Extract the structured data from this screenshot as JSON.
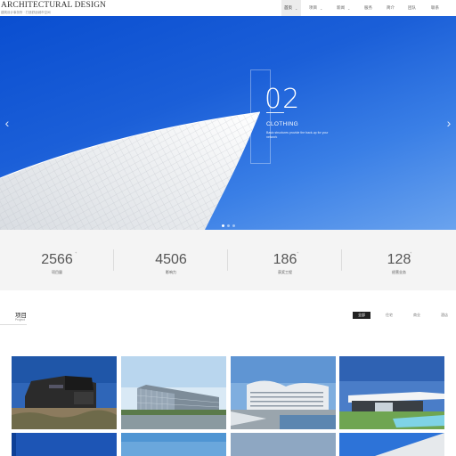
{
  "header": {
    "logo_title": "ARCHITECTURAL DESIGN",
    "logo_subtitle": "建筑设计事务所 · 打造舒适城市空间",
    "nav": [
      {
        "label": "首页",
        "active": true,
        "dropdown": true
      },
      {
        "label": "项目",
        "active": false,
        "dropdown": true
      },
      {
        "label": "新闻",
        "active": false,
        "dropdown": true
      },
      {
        "label": "服务",
        "active": false,
        "dropdown": false
      },
      {
        "label": "简介",
        "active": false,
        "dropdown": false
      },
      {
        "label": "团队",
        "active": false,
        "dropdown": false
      },
      {
        "label": "联系",
        "active": false,
        "dropdown": false
      }
    ]
  },
  "hero": {
    "slide_number": "02",
    "slide_title": "CLOTHING",
    "slide_description": "Basic structures provide the back-up for your network",
    "prev_icon": "chevron-left-icon",
    "next_icon": "chevron-right-icon",
    "dots": 3,
    "active_dot": 0,
    "background_color": "#1b5fd8"
  },
  "stats": [
    {
      "value": "2566",
      "sup": "+",
      "label": "项目量"
    },
    {
      "value": "4506",
      "sup": "",
      "label": "影响力"
    },
    {
      "value": "186",
      "sup": "+",
      "label": "获奖工程"
    },
    {
      "value": "128",
      "sup": "+",
      "label": "经营业务"
    }
  ],
  "projects": {
    "title": "项目",
    "subtitle": "Project",
    "tabs": [
      {
        "label": "全部",
        "active": true
      },
      {
        "label": "住宅",
        "active": false
      },
      {
        "label": "商业",
        "active": false
      },
      {
        "label": "酒店",
        "active": false
      }
    ]
  }
}
